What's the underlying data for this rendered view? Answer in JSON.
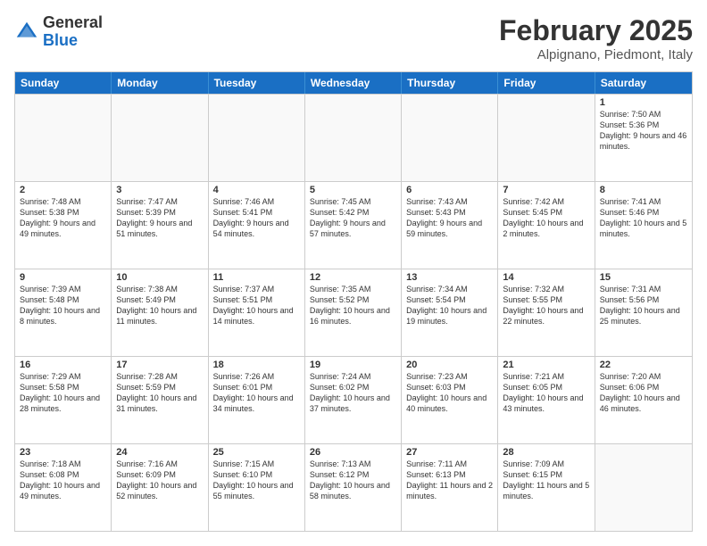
{
  "logo": {
    "general": "General",
    "blue": "Blue"
  },
  "title": "February 2025",
  "location": "Alpignano, Piedmont, Italy",
  "weekdays": [
    "Sunday",
    "Monday",
    "Tuesday",
    "Wednesday",
    "Thursday",
    "Friday",
    "Saturday"
  ],
  "rows": [
    [
      {
        "day": "",
        "text": ""
      },
      {
        "day": "",
        "text": ""
      },
      {
        "day": "",
        "text": ""
      },
      {
        "day": "",
        "text": ""
      },
      {
        "day": "",
        "text": ""
      },
      {
        "day": "",
        "text": ""
      },
      {
        "day": "1",
        "text": "Sunrise: 7:50 AM\nSunset: 5:36 PM\nDaylight: 9 hours and 46 minutes."
      }
    ],
    [
      {
        "day": "2",
        "text": "Sunrise: 7:48 AM\nSunset: 5:38 PM\nDaylight: 9 hours and 49 minutes."
      },
      {
        "day": "3",
        "text": "Sunrise: 7:47 AM\nSunset: 5:39 PM\nDaylight: 9 hours and 51 minutes."
      },
      {
        "day": "4",
        "text": "Sunrise: 7:46 AM\nSunset: 5:41 PM\nDaylight: 9 hours and 54 minutes."
      },
      {
        "day": "5",
        "text": "Sunrise: 7:45 AM\nSunset: 5:42 PM\nDaylight: 9 hours and 57 minutes."
      },
      {
        "day": "6",
        "text": "Sunrise: 7:43 AM\nSunset: 5:43 PM\nDaylight: 9 hours and 59 minutes."
      },
      {
        "day": "7",
        "text": "Sunrise: 7:42 AM\nSunset: 5:45 PM\nDaylight: 10 hours and 2 minutes."
      },
      {
        "day": "8",
        "text": "Sunrise: 7:41 AM\nSunset: 5:46 PM\nDaylight: 10 hours and 5 minutes."
      }
    ],
    [
      {
        "day": "9",
        "text": "Sunrise: 7:39 AM\nSunset: 5:48 PM\nDaylight: 10 hours and 8 minutes."
      },
      {
        "day": "10",
        "text": "Sunrise: 7:38 AM\nSunset: 5:49 PM\nDaylight: 10 hours and 11 minutes."
      },
      {
        "day": "11",
        "text": "Sunrise: 7:37 AM\nSunset: 5:51 PM\nDaylight: 10 hours and 14 minutes."
      },
      {
        "day": "12",
        "text": "Sunrise: 7:35 AM\nSunset: 5:52 PM\nDaylight: 10 hours and 16 minutes."
      },
      {
        "day": "13",
        "text": "Sunrise: 7:34 AM\nSunset: 5:54 PM\nDaylight: 10 hours and 19 minutes."
      },
      {
        "day": "14",
        "text": "Sunrise: 7:32 AM\nSunset: 5:55 PM\nDaylight: 10 hours and 22 minutes."
      },
      {
        "day": "15",
        "text": "Sunrise: 7:31 AM\nSunset: 5:56 PM\nDaylight: 10 hours and 25 minutes."
      }
    ],
    [
      {
        "day": "16",
        "text": "Sunrise: 7:29 AM\nSunset: 5:58 PM\nDaylight: 10 hours and 28 minutes."
      },
      {
        "day": "17",
        "text": "Sunrise: 7:28 AM\nSunset: 5:59 PM\nDaylight: 10 hours and 31 minutes."
      },
      {
        "day": "18",
        "text": "Sunrise: 7:26 AM\nSunset: 6:01 PM\nDaylight: 10 hours and 34 minutes."
      },
      {
        "day": "19",
        "text": "Sunrise: 7:24 AM\nSunset: 6:02 PM\nDaylight: 10 hours and 37 minutes."
      },
      {
        "day": "20",
        "text": "Sunrise: 7:23 AM\nSunset: 6:03 PM\nDaylight: 10 hours and 40 minutes."
      },
      {
        "day": "21",
        "text": "Sunrise: 7:21 AM\nSunset: 6:05 PM\nDaylight: 10 hours and 43 minutes."
      },
      {
        "day": "22",
        "text": "Sunrise: 7:20 AM\nSunset: 6:06 PM\nDaylight: 10 hours and 46 minutes."
      }
    ],
    [
      {
        "day": "23",
        "text": "Sunrise: 7:18 AM\nSunset: 6:08 PM\nDaylight: 10 hours and 49 minutes."
      },
      {
        "day": "24",
        "text": "Sunrise: 7:16 AM\nSunset: 6:09 PM\nDaylight: 10 hours and 52 minutes."
      },
      {
        "day": "25",
        "text": "Sunrise: 7:15 AM\nSunset: 6:10 PM\nDaylight: 10 hours and 55 minutes."
      },
      {
        "day": "26",
        "text": "Sunrise: 7:13 AM\nSunset: 6:12 PM\nDaylight: 10 hours and 58 minutes."
      },
      {
        "day": "27",
        "text": "Sunrise: 7:11 AM\nSunset: 6:13 PM\nDaylight: 11 hours and 2 minutes."
      },
      {
        "day": "28",
        "text": "Sunrise: 7:09 AM\nSunset: 6:15 PM\nDaylight: 11 hours and 5 minutes."
      },
      {
        "day": "",
        "text": ""
      }
    ]
  ]
}
